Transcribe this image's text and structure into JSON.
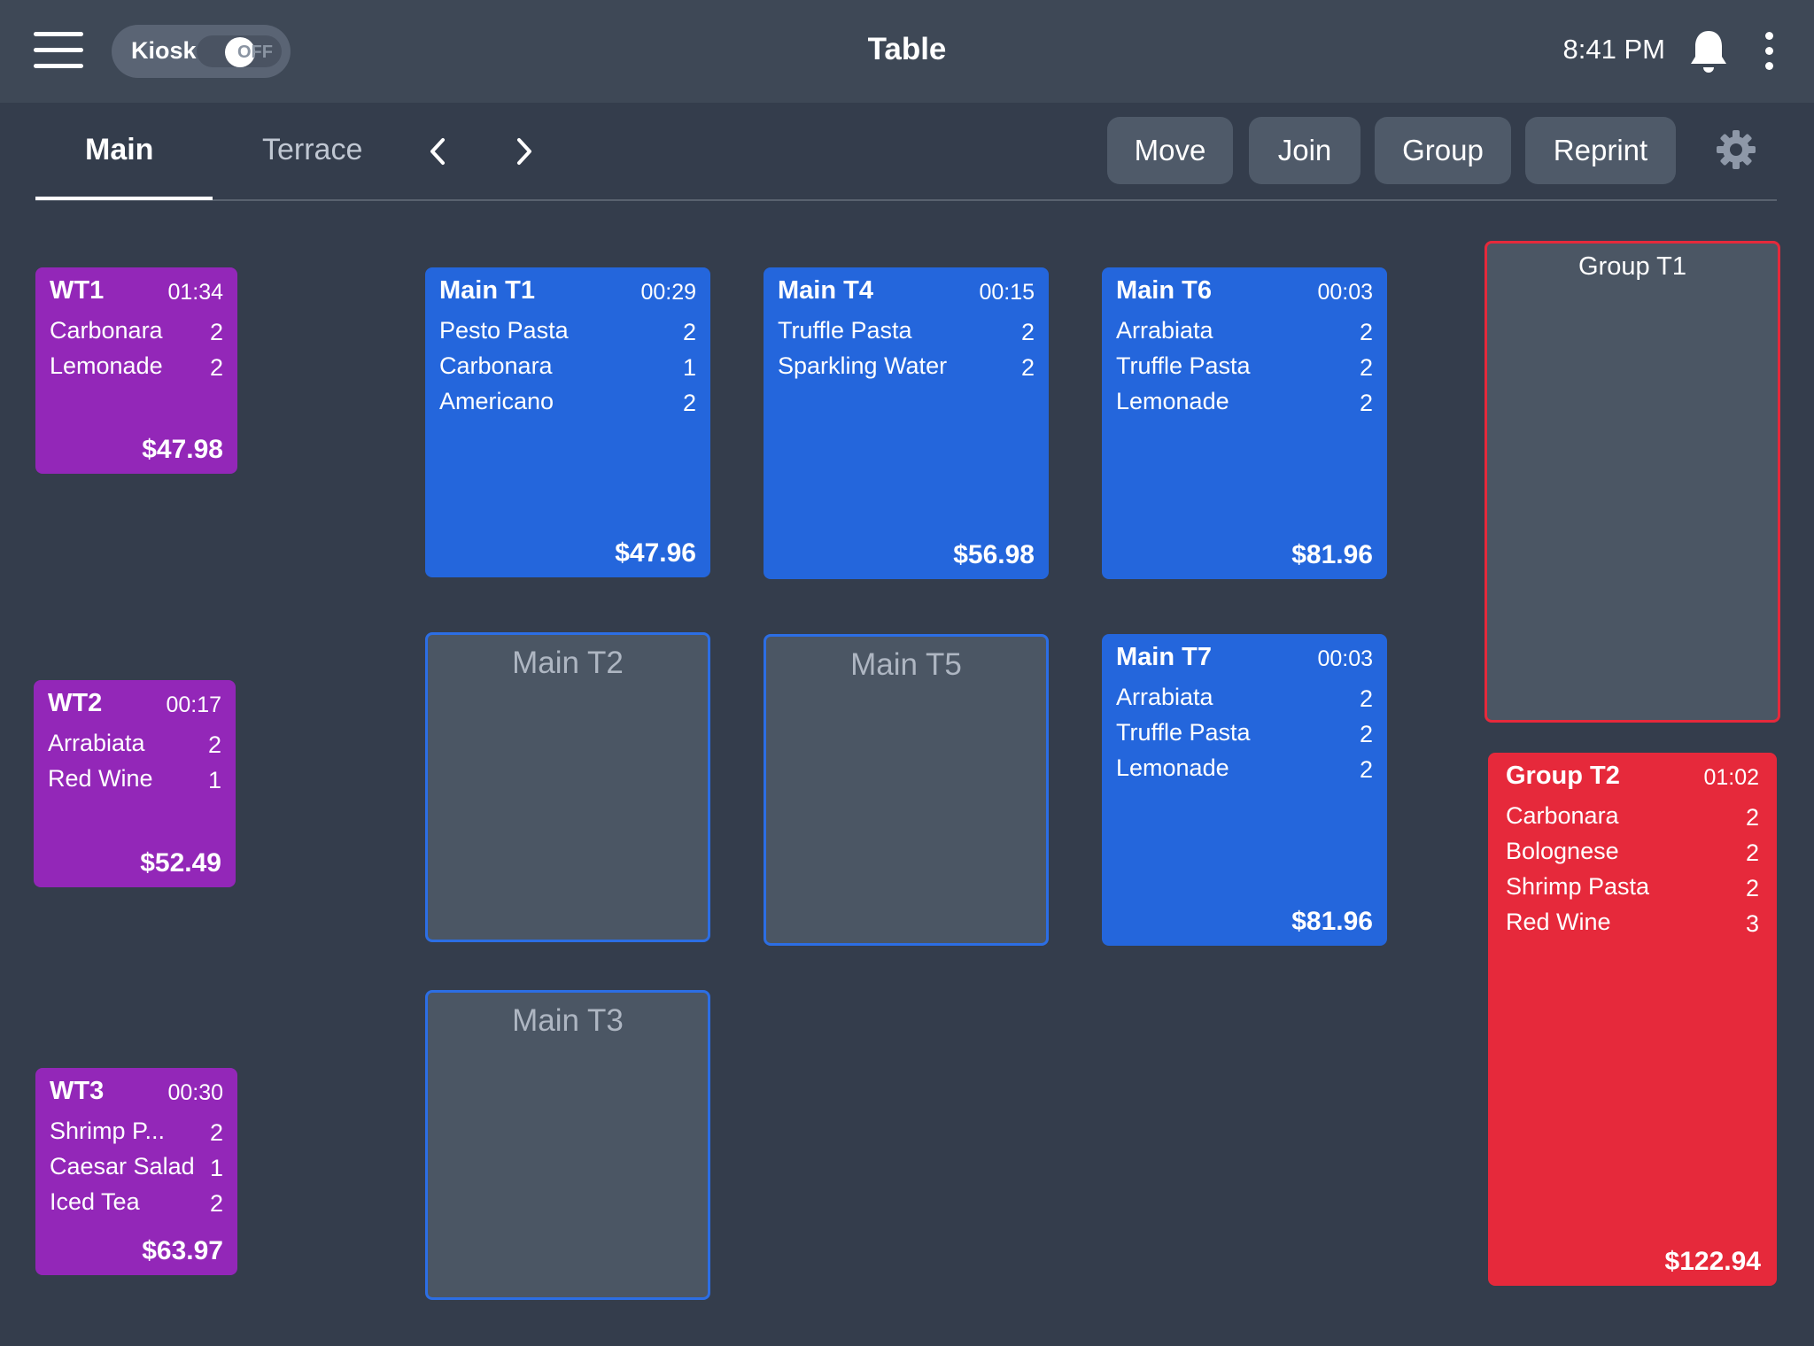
{
  "header": {
    "title": "Table",
    "time": "8:41 PM",
    "kiosk": {
      "label": "Kiosk",
      "state": "OFF"
    }
  },
  "tabs": [
    {
      "label": "Main",
      "active": true
    },
    {
      "label": "Terrace",
      "active": false
    }
  ],
  "actions": {
    "move": "Move",
    "join": "Join",
    "group": "Group",
    "reprint": "Reprint"
  },
  "colors": {
    "background": "#343d4c",
    "topbar": "#3e4856",
    "waiting": "#9327b8",
    "occupied": "#2466dc",
    "group": "#e6293b",
    "empty": "#4b5664"
  },
  "tables": {
    "wt1": {
      "name": "WT1",
      "time": "01:34",
      "items": [
        {
          "name": "Carbonara",
          "qty": "2"
        },
        {
          "name": "Lemonade",
          "qty": "2"
        }
      ],
      "total": "$47.98"
    },
    "wt2": {
      "name": "WT2",
      "time": "00:17",
      "items": [
        {
          "name": "Arrabiata",
          "qty": "2"
        },
        {
          "name": "Red Wine",
          "qty": "1"
        }
      ],
      "total": "$52.49"
    },
    "wt3": {
      "name": "WT3",
      "time": "00:30",
      "items": [
        {
          "name": "Shrimp P...",
          "qty": "2"
        },
        {
          "name": "Caesar Salad",
          "qty": "1"
        },
        {
          "name": "Iced Tea",
          "qty": "2"
        }
      ],
      "total": "$63.97"
    },
    "main_t1": {
      "name": "Main T1",
      "time": "00:29",
      "items": [
        {
          "name": "Pesto Pasta",
          "qty": "2"
        },
        {
          "name": "Carbonara",
          "qty": "1"
        },
        {
          "name": "Americano",
          "qty": "2"
        }
      ],
      "total": "$47.96"
    },
    "main_t4": {
      "name": "Main T4",
      "time": "00:15",
      "items": [
        {
          "name": "Truffle Pasta",
          "qty": "2"
        },
        {
          "name": "Sparkling Water",
          "qty": "2"
        }
      ],
      "total": "$56.98"
    },
    "main_t6": {
      "name": "Main T6",
      "time": "00:03",
      "items": [
        {
          "name": "Arrabiata",
          "qty": "2"
        },
        {
          "name": "Truffle Pasta",
          "qty": "2"
        },
        {
          "name": "Lemonade",
          "qty": "2"
        }
      ],
      "total": "$81.96"
    },
    "main_t7": {
      "name": "Main T7",
      "time": "00:03",
      "items": [
        {
          "name": "Arrabiata",
          "qty": "2"
        },
        {
          "name": "Truffle Pasta",
          "qty": "2"
        },
        {
          "name": "Lemonade",
          "qty": "2"
        }
      ],
      "total": "$81.96"
    },
    "main_t2": {
      "name": "Main T2"
    },
    "main_t5": {
      "name": "Main T5"
    },
    "main_t3": {
      "name": "Main T3"
    },
    "group_t1": {
      "name": "Group T1"
    },
    "group_t2": {
      "name": "Group T2",
      "time": "01:02",
      "items": [
        {
          "name": "Carbonara",
          "qty": "2"
        },
        {
          "name": "Bolognese",
          "qty": "2"
        },
        {
          "name": "Shrimp Pasta",
          "qty": "2"
        },
        {
          "name": "Red Wine",
          "qty": "3"
        }
      ],
      "total": "$122.94"
    }
  }
}
